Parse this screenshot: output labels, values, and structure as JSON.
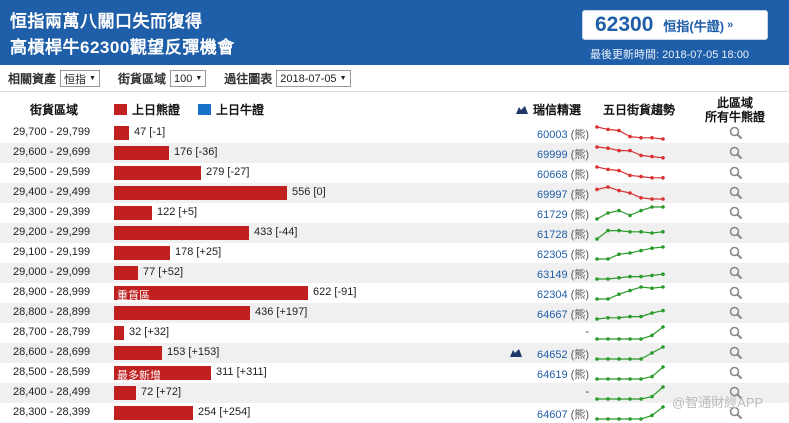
{
  "header": {
    "title_line1": "恒指兩萬八關口失而復得",
    "title_line2": "高槓桿牛62300觀望反彈機會",
    "quote_value": "62300",
    "quote_index": "恒指(牛證)",
    "quote_chevron": "»",
    "updated": "最後更新時間: 2018-07-05 18:00"
  },
  "filters": {
    "asset_label": "相關資產",
    "asset_value": "恒指",
    "interval_label": "街貨區域",
    "interval_value": "100",
    "date_label": "過往圖表",
    "date_value": "2018-07-05"
  },
  "table_header": {
    "range": "街貨區域",
    "bear_legend": "上日熊證",
    "bull_legend": "上日牛證",
    "issuer": "瑞信精選",
    "trend": "五日街貨趨勢",
    "all_line1": "此區域",
    "all_line2": "所有牛熊證"
  },
  "colors": {
    "header_bg": "#1f5ea8",
    "bear": "#c02020",
    "bull": "#1a72c8",
    "trend_down": "#d93030",
    "trend_up": "#2a9a2a"
  },
  "rows": [
    {
      "range": "29,700 - 29,799",
      "value": "47",
      "change": "[-1]",
      "bar": 47,
      "tag": "",
      "code": "60003",
      "type": "(熊)",
      "ship": false,
      "trend": "down",
      "spark": [
        0.0,
        0.2,
        0.3,
        0.8,
        0.9,
        0.9,
        1.0
      ]
    },
    {
      "range": "29,600 - 29,699",
      "value": "176",
      "change": "[-36]",
      "bar": 176,
      "tag": "",
      "code": "69999",
      "type": "(熊)",
      "ship": false,
      "trend": "down",
      "spark": [
        0.0,
        0.1,
        0.3,
        0.3,
        0.7,
        0.8,
        0.9
      ]
    },
    {
      "range": "29,500 - 29,599",
      "value": "279",
      "change": "[-27]",
      "bar": 279,
      "tag": "",
      "code": "60668",
      "type": "(熊)",
      "ship": false,
      "trend": "down",
      "spark": [
        0.0,
        0.2,
        0.3,
        0.7,
        0.8,
        0.9,
        0.9
      ]
    },
    {
      "range": "29,400 - 29,499",
      "value": "556",
      "change": "[0]",
      "bar": 556,
      "tag": "",
      "code": "69997",
      "type": "(熊)",
      "ship": false,
      "trend": "down",
      "spark": [
        0.2,
        0.0,
        0.3,
        0.5,
        0.9,
        1.0,
        1.0
      ]
    },
    {
      "range": "29,300 - 29,399",
      "value": "122",
      "change": "[+5]",
      "bar": 122,
      "tag": "",
      "code": "61729",
      "type": "(熊)",
      "ship": false,
      "trend": "up",
      "spark": [
        1.0,
        0.5,
        0.3,
        0.7,
        0.3,
        0.0,
        0.0
      ]
    },
    {
      "range": "29,200 - 29,299",
      "value": "433",
      "change": "[-44]",
      "bar": 433,
      "tag": "",
      "code": "61728",
      "type": "(熊)",
      "ship": false,
      "trend": "up",
      "spark": [
        1.0,
        0.3,
        0.3,
        0.4,
        0.4,
        0.5,
        0.4
      ]
    },
    {
      "range": "29,100 - 29,199",
      "value": "178",
      "change": "[+25]",
      "bar": 178,
      "tag": "",
      "code": "62305",
      "type": "(熊)",
      "ship": false,
      "trend": "up",
      "spark": [
        1.0,
        1.0,
        0.6,
        0.5,
        0.3,
        0.1,
        0.0
      ]
    },
    {
      "range": "29,000 - 29,099",
      "value": "77",
      "change": "[+52]",
      "bar": 77,
      "tag": "",
      "code": "63149",
      "type": "(熊)",
      "ship": false,
      "trend": "up",
      "spark": [
        1.0,
        1.0,
        0.9,
        0.8,
        0.8,
        0.7,
        0.6
      ]
    },
    {
      "range": "28,900 - 28,999",
      "value": "622",
      "change": "[-91]",
      "bar": 622,
      "tag": "重貨區",
      "code": "62304",
      "type": "(熊)",
      "ship": false,
      "trend": "up",
      "spark": [
        1.0,
        1.0,
        0.6,
        0.3,
        0.0,
        0.1,
        0.0
      ]
    },
    {
      "range": "28,800 - 28,899",
      "value": "436",
      "change": "[+197]",
      "bar": 436,
      "tag": "",
      "code": "64667",
      "type": "(熊)",
      "ship": false,
      "trend": "up",
      "spark": [
        1.0,
        0.9,
        0.9,
        0.8,
        0.8,
        0.5,
        0.3
      ]
    },
    {
      "range": "28,700 - 28,799",
      "value": "32",
      "change": "[+32]",
      "bar": 32,
      "tag": "",
      "code": "-",
      "type": "",
      "ship": false,
      "trend": "up",
      "spark": [
        1.0,
        1.0,
        1.0,
        1.0,
        1.0,
        0.7,
        0.0
      ]
    },
    {
      "range": "28,600 - 28,699",
      "value": "153",
      "change": "[+153]",
      "bar": 153,
      "tag": "",
      "code": "64652",
      "type": "(熊)",
      "ship": true,
      "trend": "up",
      "spark": [
        1.0,
        1.0,
        1.0,
        1.0,
        1.0,
        0.5,
        0.0
      ]
    },
    {
      "range": "28,500 - 28,599",
      "value": "311",
      "change": "[+311]",
      "bar": 311,
      "tag": "最多新增",
      "code": "64619",
      "type": "(熊)",
      "ship": false,
      "trend": "up",
      "spark": [
        1.0,
        1.0,
        1.0,
        1.0,
        1.0,
        0.8,
        0.0
      ]
    },
    {
      "range": "28,400 - 28,499",
      "value": "72",
      "change": "[+72]",
      "bar": 72,
      "tag": "",
      "code": "-",
      "type": "",
      "ship": false,
      "trend": "up",
      "spark": [
        1.0,
        1.0,
        1.0,
        1.0,
        1.0,
        0.8,
        0.0
      ]
    },
    {
      "range": "28,300 - 28,399",
      "value": "254",
      "change": "[+254]",
      "bar": 254,
      "tag": "",
      "code": "64607",
      "type": "(熊)",
      "ship": false,
      "trend": "up",
      "spark": [
        1.0,
        1.0,
        1.0,
        1.0,
        1.0,
        0.7,
        0.0
      ]
    }
  ],
  "watermark": "@智通財經APP"
}
